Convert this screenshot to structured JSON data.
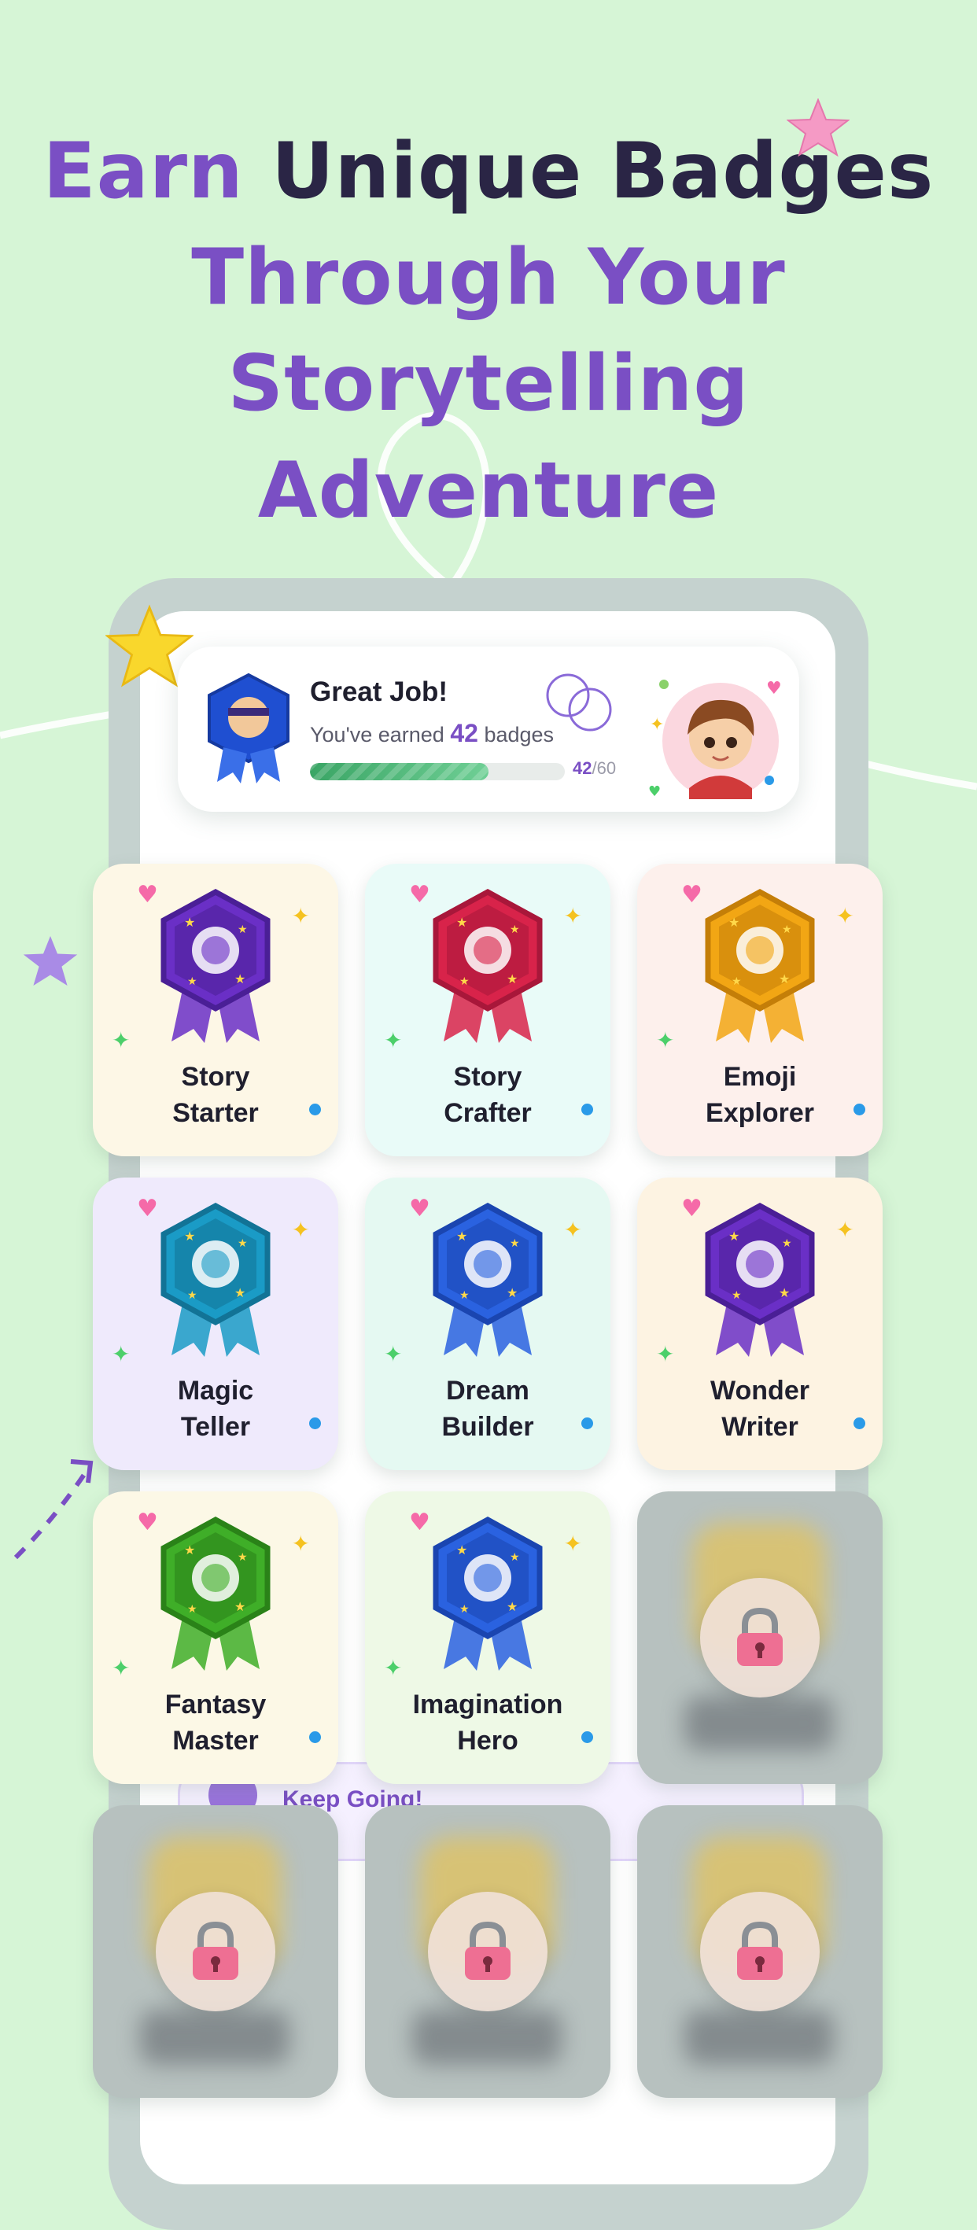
{
  "headline": {
    "line1_a": "Earn",
    "line1_b": "Unique Badges",
    "line2": "Through Your",
    "line3": "Storytelling Adventure"
  },
  "summary": {
    "title": "Great Job!",
    "subtitle_prefix": "You've earned",
    "earned": "42",
    "subtitle_suffix": "badges",
    "progress_label_current": "42",
    "progress_label_sep": "/",
    "progress_label_total": "60",
    "progress_fraction": 0.7
  },
  "badges": [
    {
      "line1": "Story",
      "line2": "Starter",
      "color": "#fdf7e6",
      "locked": false
    },
    {
      "line1": "Story",
      "line2": "Crafter",
      "color": "#e9fbf8",
      "locked": false
    },
    {
      "line1": "Emoji",
      "line2": "Explorer",
      "color": "#fdf0ec",
      "locked": false
    },
    {
      "line1": "Magic",
      "line2": "Teller",
      "color": "#efeafc",
      "locked": false
    },
    {
      "line1": "Dream",
      "line2": "Builder",
      "color": "#e5f9f2",
      "locked": false
    },
    {
      "line1": "Wonder",
      "line2": "Writer",
      "color": "#fdf3e2",
      "locked": false
    },
    {
      "line1": "Fantasy",
      "line2": "Master",
      "color": "#fcf8e6",
      "locked": false
    },
    {
      "line1": "Imagination",
      "line2": "Hero",
      "color": "#eef9e6",
      "locked": false
    },
    {
      "locked": true
    },
    {
      "locked": true
    },
    {
      "locked": true
    },
    {
      "locked": true
    }
  ],
  "keep_going": {
    "title": "Keep Going!"
  },
  "colors": {
    "background": "#d6f5d6",
    "accent_purple": "#7a4fc4",
    "navy": "#2a2545",
    "progress_green": "#3aa565"
  }
}
